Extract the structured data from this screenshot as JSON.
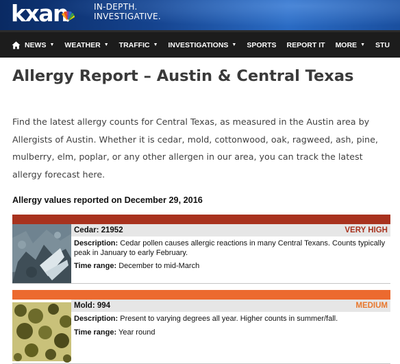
{
  "header": {
    "logo_text": "kxan",
    "tagline_line1": "IN-DEPTH.",
    "tagline_line2": "INVESTIGATIVE."
  },
  "nav": {
    "home_icon": "home-icon",
    "items": [
      {
        "label": "NEWS",
        "dropdown": true
      },
      {
        "label": "WEATHER",
        "dropdown": true
      },
      {
        "label": "TRAFFIC",
        "dropdown": true
      },
      {
        "label": "INVESTIGATIONS",
        "dropdown": true
      },
      {
        "label": "SPORTS",
        "dropdown": false
      },
      {
        "label": "REPORT IT",
        "dropdown": false
      },
      {
        "label": "MORE",
        "dropdown": true
      },
      {
        "label": "STU",
        "dropdown": false
      }
    ]
  },
  "page": {
    "title": "Allergy Report – Austin & Central Texas",
    "intro": "Find the latest allergy counts for Central Texas, as measured in the Austin area by Allergists of Austin. Whether it is cedar, mold, cottonwood, oak, ragweed, ash, pine, mulberry, elm, poplar, or any other allergen in our area, you can track the latest allergy forecast here.",
    "report_date": "Allergy values reported on December 29, 2016"
  },
  "labels": {
    "description": "Description:",
    "time_range": "Time range:"
  },
  "allergens": [
    {
      "name": "Cedar: 21952",
      "level": "VERY HIGH",
      "level_color": "#a8321e",
      "bar_color": "#a8321e",
      "description": "Cedar pollen causes allergic reactions in many Central Texans. Counts typically peak in January to early February.",
      "time_range": "December to mid-March"
    },
    {
      "name": "Mold: 994",
      "level": "MEDIUM",
      "level_color": "#e8772c",
      "bar_color": "#ec6a2f",
      "description": "Present to varying degrees all year. Higher counts in summer/fall.",
      "time_range": "Year round"
    }
  ]
}
